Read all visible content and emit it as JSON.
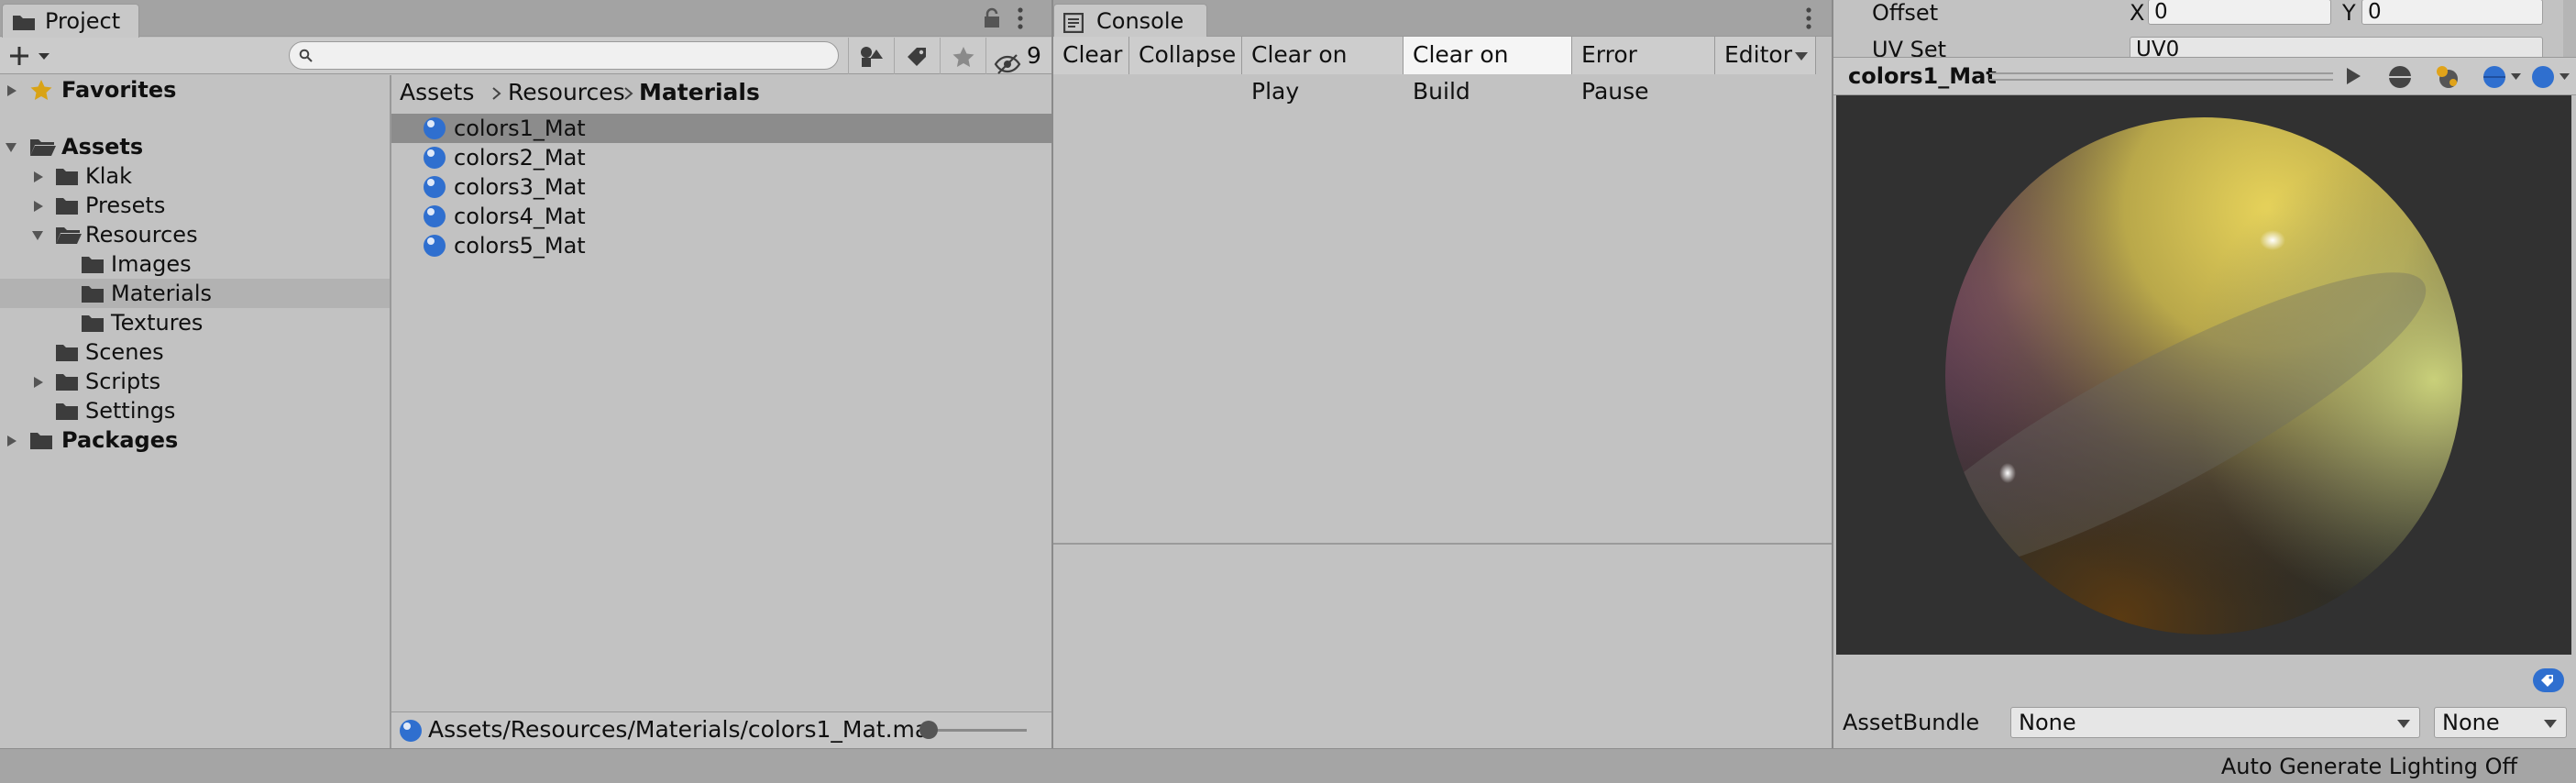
{
  "project": {
    "tab_label": "Project",
    "search": {
      "value": "",
      "placeholder": ""
    },
    "hidden_count": "9",
    "tree": [
      {
        "label": "Favorites",
        "bold": true
      },
      {
        "label": "Assets",
        "bold": true
      },
      {
        "label": "Klak"
      },
      {
        "label": "Presets"
      },
      {
        "label": "Resources"
      },
      {
        "label": "Images"
      },
      {
        "label": "Materials"
      },
      {
        "label": "Textures"
      },
      {
        "label": "Scenes"
      },
      {
        "label": "Scripts"
      },
      {
        "label": "Settings"
      },
      {
        "label": "Packages",
        "bold": true
      }
    ],
    "breadcrumb": [
      "Assets",
      "Resources",
      "Materials"
    ],
    "files": [
      "colors1_Mat",
      "colors2_Mat",
      "colors3_Mat",
      "colors4_Mat",
      "colors5_Mat"
    ],
    "selected_path": "Assets/Resources/Materials/colors1_Mat.ma"
  },
  "console": {
    "tab_label": "Console",
    "buttons": {
      "clear": "Clear",
      "collapse": "Collapse",
      "clear_on_play": "Clear on Play",
      "clear_on_build": "Clear on Build",
      "error_pause": "Error Pause",
      "editor": "Editor"
    }
  },
  "inspector": {
    "offset_label": "Offset",
    "offset_x_label": "X",
    "offset_x": "0",
    "offset_y_label": "Y",
    "offset_y": "0",
    "uvset_label": "UV Set",
    "uvset_value": "UV0",
    "preview_title": "colors1_Mat",
    "assetbundle_label": "AssetBundle",
    "assetbundle_value": "None",
    "assetbundle_variant": "None"
  },
  "status": {
    "text": "Auto Generate Lighting Off"
  },
  "colors": {
    "accent_blue": "#2f6fcf",
    "favorites_star": "#d9a316"
  }
}
